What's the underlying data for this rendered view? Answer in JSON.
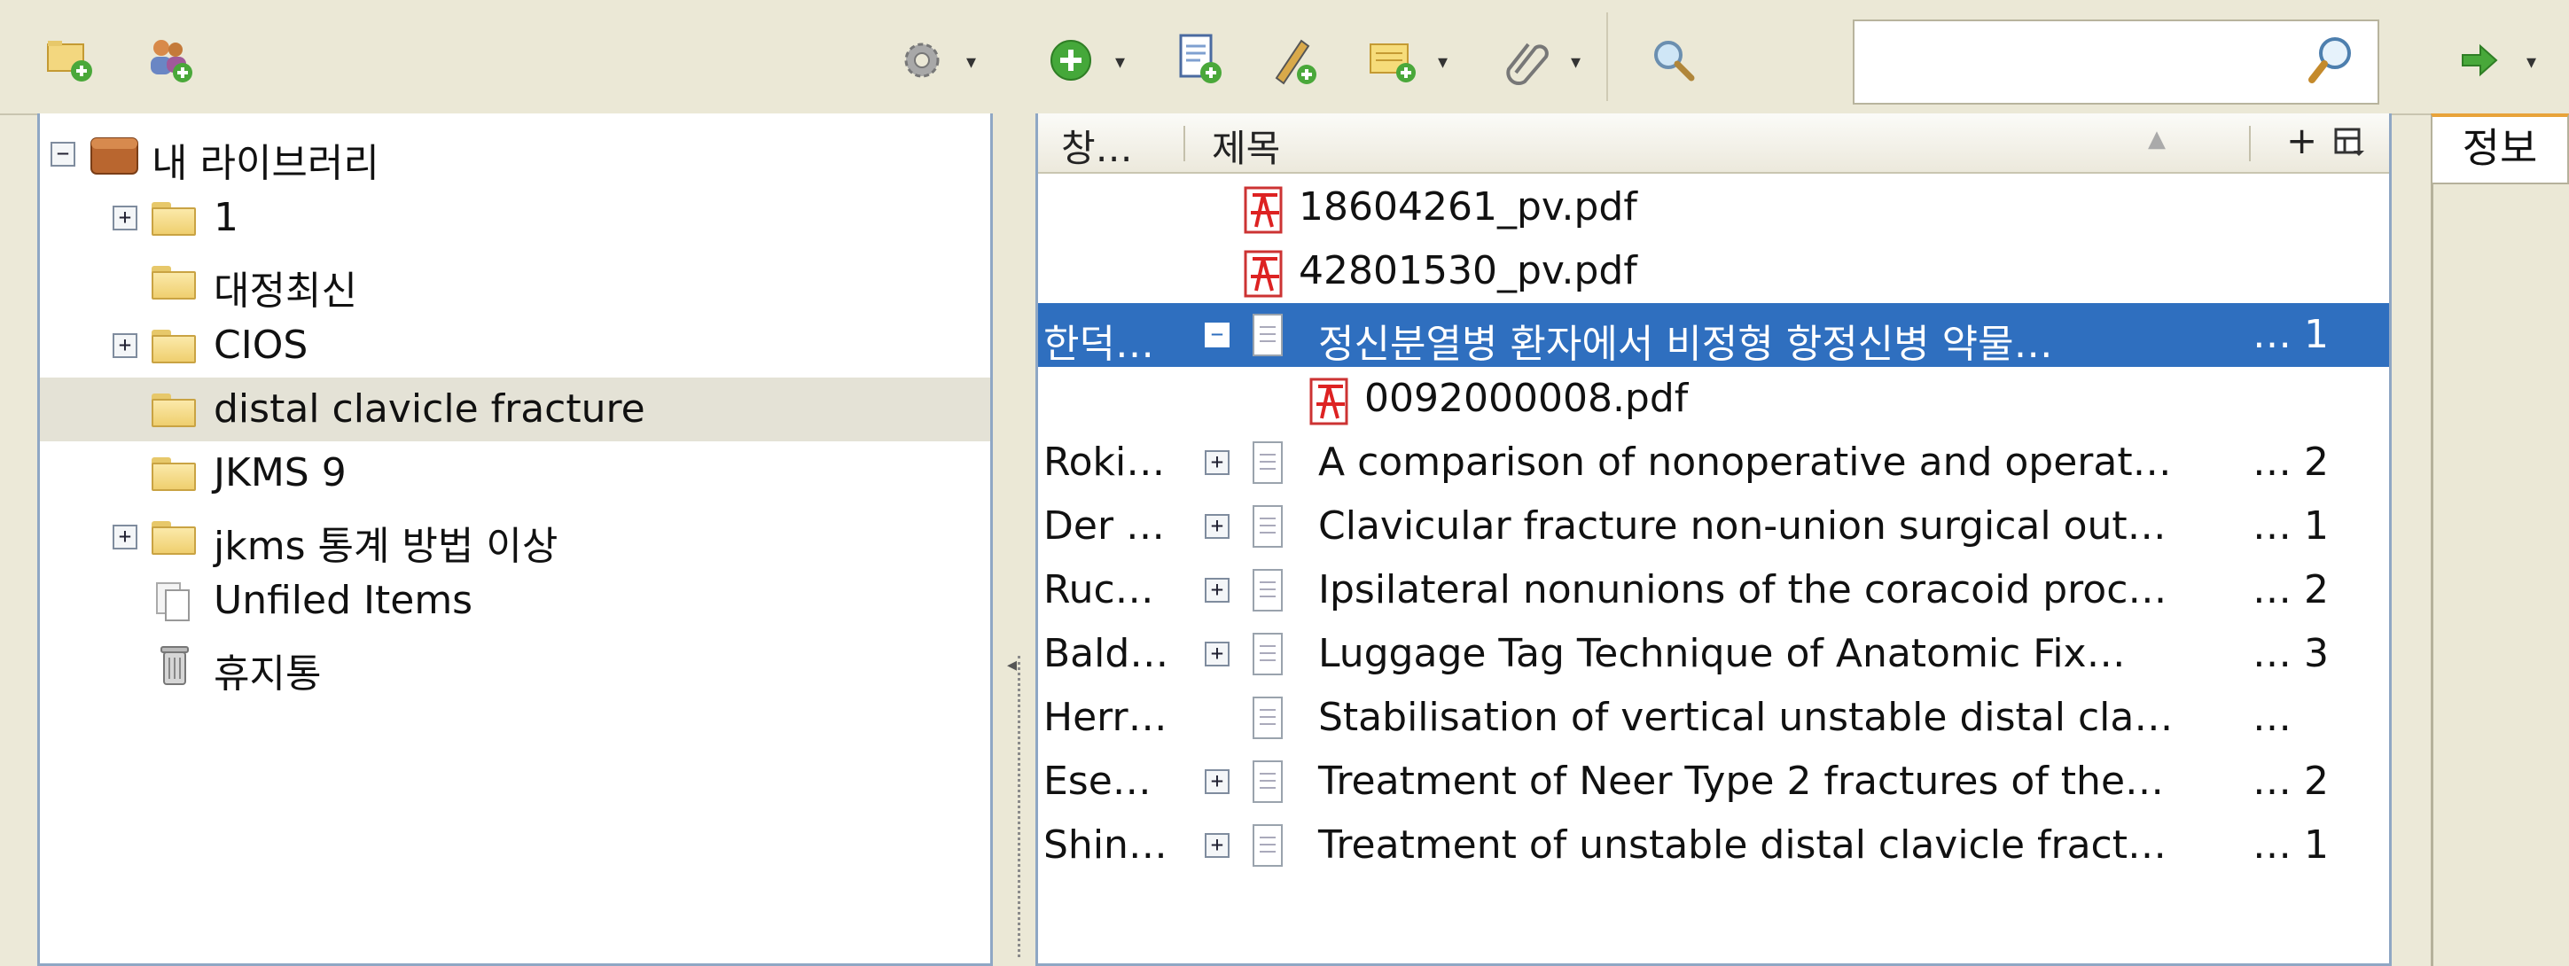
{
  "toolbar": {
    "search_value": ""
  },
  "tree": {
    "items": [
      {
        "label": "내 라이브러리",
        "expander": "−"
      },
      {
        "label": "1",
        "expander": "+"
      },
      {
        "label": "대정최신"
      },
      {
        "label": "CIOS",
        "expander": "+"
      },
      {
        "label": "distal clavicle fracture"
      },
      {
        "label": "JKMS 9"
      },
      {
        "label": "jkms 통계 방법 이상",
        "expander": "+"
      },
      {
        "label": "Unfiled Items"
      },
      {
        "label": "휴지통"
      }
    ]
  },
  "columns": {
    "creator": "창…",
    "title": "제목",
    "plus": "+"
  },
  "items": [
    {
      "creator": "",
      "title": "18604261_pv.pdf",
      "count": "",
      "type": "pdf",
      "indent": 1
    },
    {
      "creator": "",
      "title": "42801530_pv.pdf",
      "count": "",
      "type": "pdf",
      "indent": 1
    },
    {
      "creator": "한덕…",
      "expander": "−",
      "title": "정신분열병 환자에서 비정형 항정신병 약물…",
      "count": "… 1",
      "type": "doc",
      "selected": true
    },
    {
      "creator": "",
      "title": "0092000008.pdf",
      "count": "",
      "type": "pdf",
      "indent": 2
    },
    {
      "creator": "Roki…",
      "expander": "+",
      "title": "A comparison of nonoperative and operat…",
      "count": "… 2",
      "type": "doc"
    },
    {
      "creator": "Der …",
      "expander": "+",
      "title": "Clavicular fracture non-union surgical out…",
      "count": "… 1",
      "type": "doc"
    },
    {
      "creator": "Ruc…",
      "expander": "+",
      "title": "Ipsilateral nonunions of the coracoid proc…",
      "count": "… 2",
      "type": "doc"
    },
    {
      "creator": "Bald…",
      "expander": "+",
      "title": "Luggage Tag Technique of Anatomic Fix…",
      "count": "… 3",
      "type": "doc"
    },
    {
      "creator": "Herr…",
      "title": "Stabilisation of vertical unstable distal cla…",
      "count": "…",
      "type": "doc"
    },
    {
      "creator": "Ese…",
      "expander": "+",
      "title": "Treatment of Neer Type 2 fractures of the…",
      "count": "… 2",
      "type": "doc"
    },
    {
      "creator": "Shin…",
      "expander": "+",
      "title": "Treatment of unstable distal clavicle fract…",
      "count": "… 1",
      "type": "doc"
    }
  ],
  "right_pane": {
    "tab_label": "정보"
  }
}
